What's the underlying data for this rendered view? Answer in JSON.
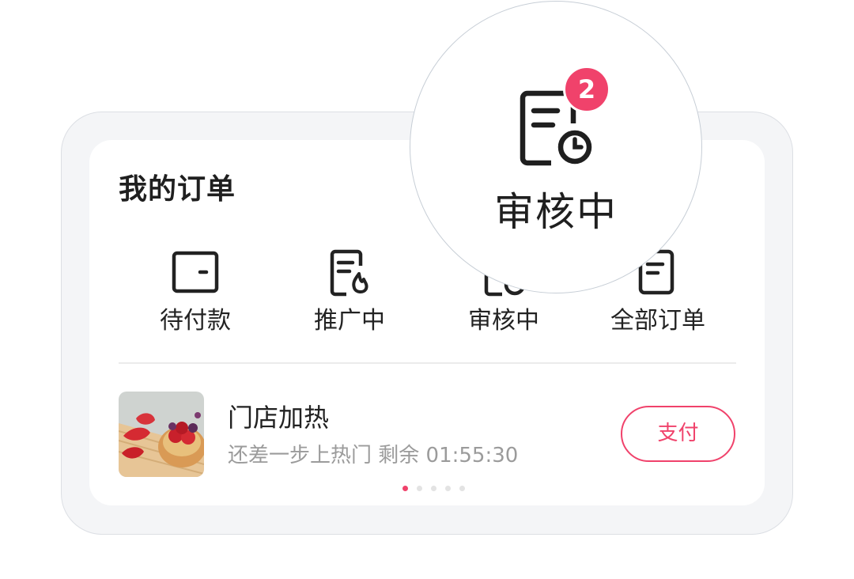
{
  "orders": {
    "title": "我的订单",
    "nav": [
      {
        "label": "待付款",
        "icon": "wallet-icon"
      },
      {
        "label": "推广中",
        "icon": "document-flame-icon"
      },
      {
        "label": "审核中",
        "icon": "document-clock-icon"
      },
      {
        "label": "全部订单",
        "icon": "document-list-icon"
      }
    ],
    "current_order": {
      "name": "门店加热",
      "subtitle": "还差一步上热门 剩余 01:55:30",
      "pay_label": "支付",
      "thumb": "strawberry-tart-image"
    },
    "carousel": {
      "pages": 5,
      "active": 1
    }
  },
  "magnifier": {
    "label": "审核中",
    "badge": "2",
    "icon": "document-clock-icon"
  },
  "colors": {
    "accent": "#f0426b",
    "text_primary": "#222222",
    "text_secondary": "#9b9b9b",
    "frame_bg": "#f4f5f7"
  }
}
